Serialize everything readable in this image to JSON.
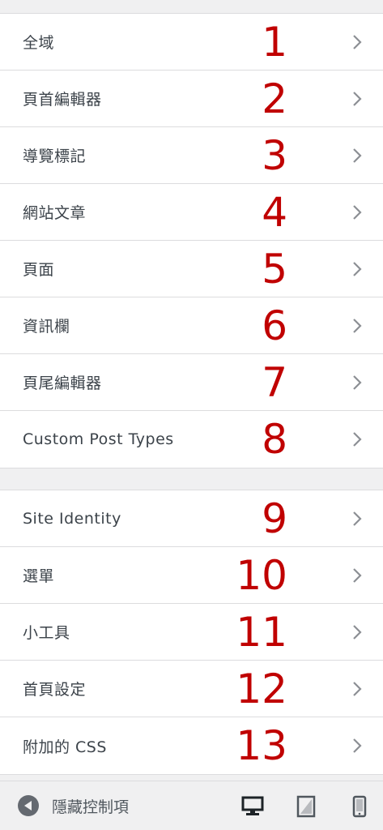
{
  "sections": [
    {
      "items": [
        {
          "label": "全域",
          "number": "1"
        },
        {
          "label": "頁首編輯器",
          "number": "2"
        },
        {
          "label": "導覽標記",
          "number": "3"
        },
        {
          "label": "網站文章",
          "number": "4"
        },
        {
          "label": "頁面",
          "number": "5"
        },
        {
          "label": "資訊欄",
          "number": "6"
        },
        {
          "label": "頁尾編輯器",
          "number": "7"
        },
        {
          "label": "Custom Post Types",
          "number": "8"
        }
      ]
    },
    {
      "items": [
        {
          "label": "Site Identity",
          "number": "9"
        },
        {
          "label": "選單",
          "number": "10"
        },
        {
          "label": "小工具",
          "number": "11"
        },
        {
          "label": "首頁設定",
          "number": "12"
        },
        {
          "label": "附加的 CSS",
          "number": "13"
        }
      ]
    }
  ],
  "footer": {
    "collapse_label": "隱藏控制項",
    "devices": [
      "desktop-icon",
      "tablet-icon",
      "mobile-icon"
    ]
  },
  "colors": {
    "number": "#c00000",
    "text": "#3c434a",
    "chevron": "#8c8f94",
    "background": "#f0f0f1"
  }
}
